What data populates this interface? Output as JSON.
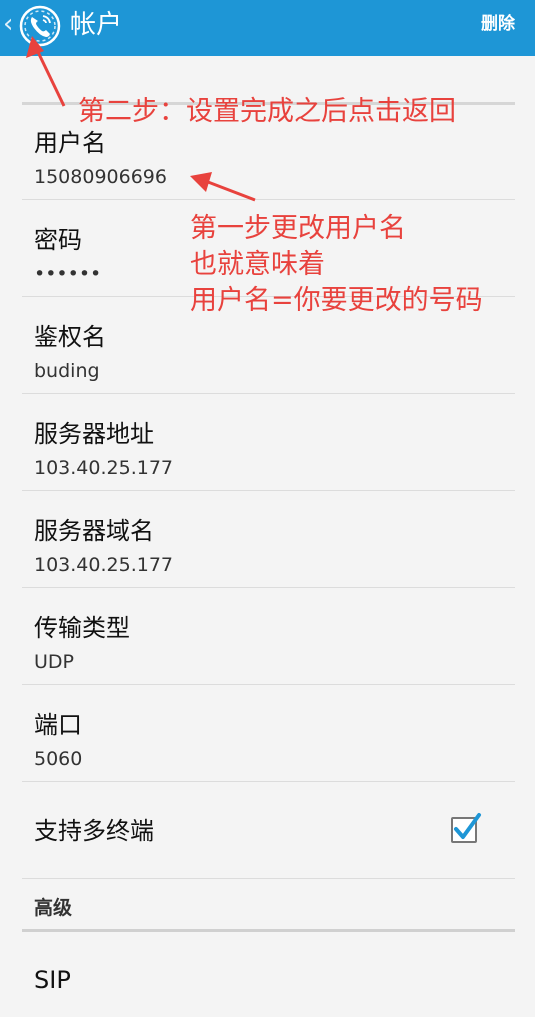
{
  "appbar": {
    "back_glyph": "‹",
    "title": "帐户",
    "delete_label": "删除",
    "icon": "phone-call-icon"
  },
  "settings": [
    {
      "label": "用户名",
      "value": "15080906696"
    },
    {
      "label": "密码",
      "value": "••••••"
    },
    {
      "label": "鉴权名",
      "value": "buding"
    },
    {
      "label": "服务器地址",
      "value": "103.40.25.177"
    },
    {
      "label": "服务器域名",
      "value": "103.40.25.177"
    },
    {
      "label": "传输类型",
      "value": "UDP"
    },
    {
      "label": "端口",
      "value": "5060"
    }
  ],
  "multi_terminal": {
    "label": "支持多终端",
    "checked": true
  },
  "advanced": {
    "header": "高级",
    "sip_label": "SIP"
  },
  "annotations": {
    "step2": "第二步：设置完成之后点击返回",
    "step1_line1": "第一步更改用户名",
    "step1_line2": "也就意味着",
    "step1_line3": "用户名=你要更改的号码"
  },
  "colors": {
    "appbar": "#1e96d6",
    "annotation": "#e8423d",
    "checkbox_check": "#1e96d6"
  }
}
